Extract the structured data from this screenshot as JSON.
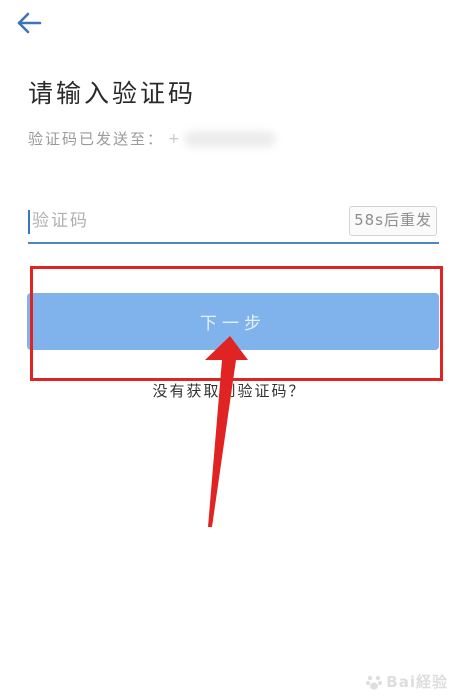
{
  "header": {
    "back_icon": "arrow-left-icon"
  },
  "title": "请输入验证码",
  "subtitle": {
    "label": "验证码已发送至：",
    "phone_prefix": "+"
  },
  "code_field": {
    "placeholder": "验证码",
    "value": "",
    "resend_label": "58s后重发"
  },
  "next_button": {
    "label": "下一步"
  },
  "no_code_link": "没有获取到验证码？",
  "colors": {
    "primary_blue": "#80b2ec",
    "underline_blue": "#4a86c8",
    "back_arrow_blue": "#3f73b8",
    "annotation_red": "#e02424"
  },
  "watermark": {
    "text": "Bai経验"
  }
}
